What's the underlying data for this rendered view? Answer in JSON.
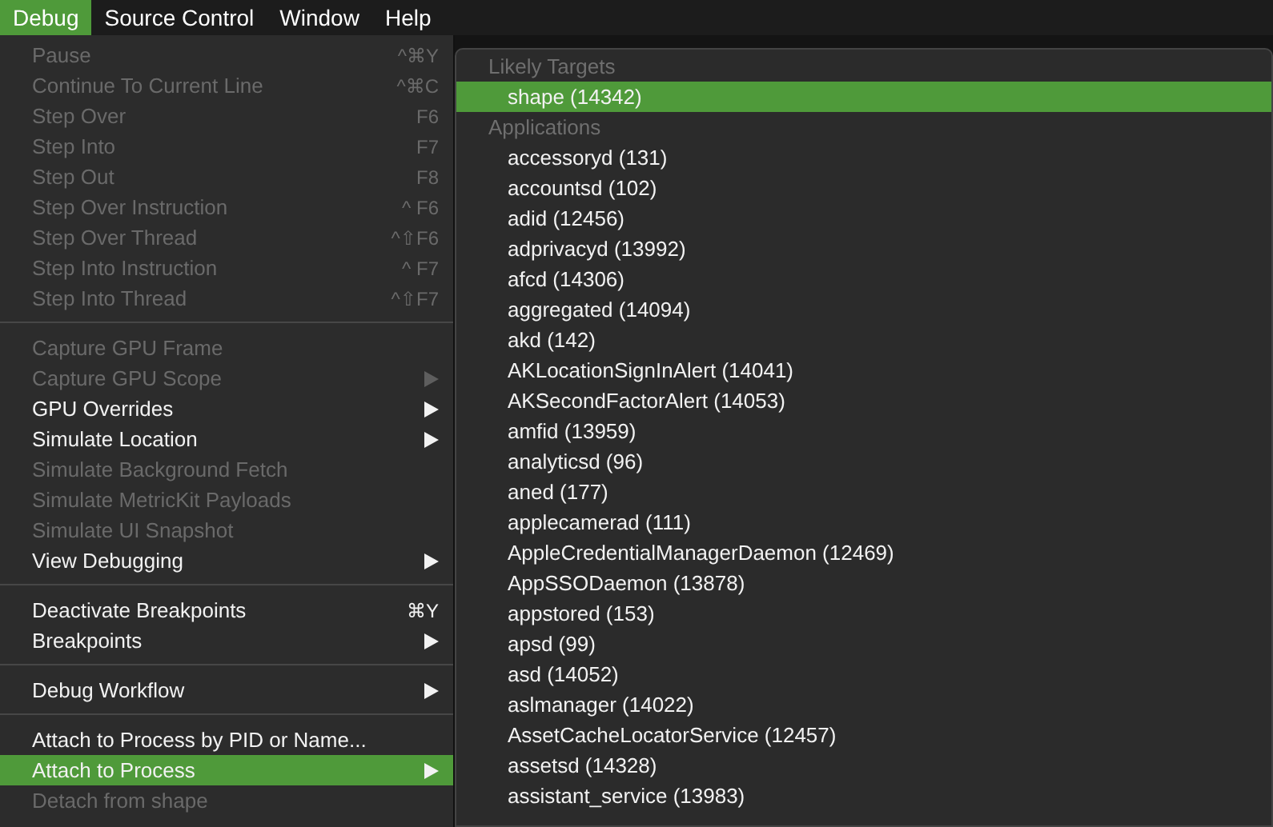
{
  "menu_bar": [
    {
      "label": "Debug",
      "selected": true
    },
    {
      "label": "Source Control",
      "selected": false
    },
    {
      "label": "Window",
      "selected": false
    },
    {
      "label": "Help",
      "selected": false
    }
  ],
  "debug_menu": [
    {
      "kind": "item",
      "label": "Pause",
      "shortcut": "^⌘Y",
      "enabled": false,
      "submenu": false,
      "selected": false
    },
    {
      "kind": "item",
      "label": "Continue To Current Line",
      "shortcut": "^⌘C",
      "enabled": false,
      "submenu": false,
      "selected": false
    },
    {
      "kind": "item",
      "label": "Step Over",
      "shortcut": "F6",
      "enabled": false,
      "submenu": false,
      "selected": false
    },
    {
      "kind": "item",
      "label": "Step Into",
      "shortcut": "F7",
      "enabled": false,
      "submenu": false,
      "selected": false
    },
    {
      "kind": "item",
      "label": "Step Out",
      "shortcut": "F8",
      "enabled": false,
      "submenu": false,
      "selected": false
    },
    {
      "kind": "item",
      "label": "Step Over Instruction",
      "shortcut": "^ F6",
      "enabled": false,
      "submenu": false,
      "selected": false
    },
    {
      "kind": "item",
      "label": "Step Over Thread",
      "shortcut": "^⇧F6",
      "enabled": false,
      "submenu": false,
      "selected": false
    },
    {
      "kind": "item",
      "label": "Step Into Instruction",
      "shortcut": "^ F7",
      "enabled": false,
      "submenu": false,
      "selected": false
    },
    {
      "kind": "item",
      "label": "Step Into Thread",
      "shortcut": "^⇧F7",
      "enabled": false,
      "submenu": false,
      "selected": false
    },
    {
      "kind": "separator"
    },
    {
      "kind": "item",
      "label": "Capture GPU Frame",
      "enabled": false,
      "submenu": false,
      "selected": false
    },
    {
      "kind": "item",
      "label": "Capture GPU Scope",
      "enabled": false,
      "submenu": true,
      "selected": false
    },
    {
      "kind": "item",
      "label": "GPU Overrides",
      "enabled": true,
      "submenu": true,
      "selected": false
    },
    {
      "kind": "item",
      "label": "Simulate Location",
      "enabled": true,
      "submenu": true,
      "selected": false
    },
    {
      "kind": "item",
      "label": "Simulate Background Fetch",
      "enabled": false,
      "submenu": false,
      "selected": false
    },
    {
      "kind": "item",
      "label": "Simulate MetricKit Payloads",
      "enabled": false,
      "submenu": false,
      "selected": false
    },
    {
      "kind": "item",
      "label": "Simulate UI Snapshot",
      "enabled": false,
      "submenu": false,
      "selected": false
    },
    {
      "kind": "item",
      "label": "View Debugging",
      "enabled": true,
      "submenu": true,
      "selected": false
    },
    {
      "kind": "separator"
    },
    {
      "kind": "item",
      "label": "Deactivate Breakpoints",
      "shortcut": "⌘Y",
      "enabled": true,
      "submenu": false,
      "selected": false
    },
    {
      "kind": "item",
      "label": "Breakpoints",
      "enabled": true,
      "submenu": true,
      "selected": false
    },
    {
      "kind": "separator"
    },
    {
      "kind": "item",
      "label": "Debug Workflow",
      "enabled": true,
      "submenu": true,
      "selected": false
    },
    {
      "kind": "separator"
    },
    {
      "kind": "item",
      "label": "Attach to Process by PID or Name...",
      "enabled": true,
      "submenu": false,
      "selected": false
    },
    {
      "kind": "item",
      "label": "Attach to Process",
      "enabled": true,
      "submenu": true,
      "selected": true
    },
    {
      "kind": "item",
      "label": "Detach from shape",
      "enabled": false,
      "submenu": false,
      "selected": false
    }
  ],
  "process_submenu": [
    {
      "header": "Likely Targets",
      "items": [
        {
          "label": "shape (14342)",
          "selected": true
        }
      ]
    },
    {
      "header": "Applications",
      "items": [
        {
          "label": "accessoryd (131)",
          "selected": false
        },
        {
          "label": "accountsd (102)",
          "selected": false
        },
        {
          "label": "adid (12456)",
          "selected": false
        },
        {
          "label": "adprivacyd (13992)",
          "selected": false
        },
        {
          "label": "afcd (14306)",
          "selected": false
        },
        {
          "label": "aggregated (14094)",
          "selected": false
        },
        {
          "label": "akd (142)",
          "selected": false
        },
        {
          "label": "AKLocationSignInAlert (14041)",
          "selected": false
        },
        {
          "label": "AKSecondFactorAlert (14053)",
          "selected": false
        },
        {
          "label": "amfid (13959)",
          "selected": false
        },
        {
          "label": "analyticsd (96)",
          "selected": false
        },
        {
          "label": "aned (177)",
          "selected": false
        },
        {
          "label": "applecamerad (111)",
          "selected": false
        },
        {
          "label": "AppleCredentialManagerDaemon (12469)",
          "selected": false
        },
        {
          "label": "AppSSODaemon (13878)",
          "selected": false
        },
        {
          "label": "appstored (153)",
          "selected": false
        },
        {
          "label": "apsd (99)",
          "selected": false
        },
        {
          "label": "asd (14052)",
          "selected": false
        },
        {
          "label": "aslmanager (14022)",
          "selected": false
        },
        {
          "label": "AssetCacheLocatorService (12457)",
          "selected": false
        },
        {
          "label": "assetsd (14328)",
          "selected": false
        },
        {
          "label": "assistant_service (13983)",
          "selected": false
        }
      ]
    }
  ]
}
